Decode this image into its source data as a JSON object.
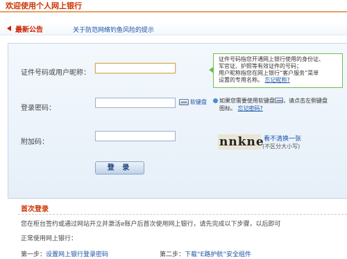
{
  "header": {
    "title": "欢迎使用个人网上银行"
  },
  "notice": {
    "label": "最新公告",
    "link_text": "关于防范网络钓鱼风险的提示"
  },
  "form": {
    "id_label": "证件号码或用户昵称：",
    "password_label": "登录密码：",
    "captcha_label": "附加码：",
    "keyboard_label": "软键盘",
    "captcha_text": "nnkne",
    "captcha_refresh": "看不清换一张",
    "captcha_case_note": "(不区分大小写)",
    "login_button": "登 录"
  },
  "tips": {
    "id_tip_line1": "证件号码指您开通网上银行使用的身份证、",
    "id_tip_line2": "军官证、护照等有效证件的号码；",
    "id_tip_line3": "用户昵称指您在网上银行“客户服务”菜单",
    "id_tip_line4": "设置的专用名称。",
    "id_tip_link": "忘记昵称?",
    "pwd_tip_line1": "如果您需要使用软键盘",
    "pwd_tip_line1b": "，请点击左侧键盘",
    "pwd_tip_line2": "图标。",
    "pwd_tip_link": "忘记密码?"
  },
  "first_login": {
    "title": "首次登录",
    "desc": "您在柜台签约或通过网站开立并激活e账户后首次使用网上银行，请先完成以下步骤，以后即可",
    "normal": "正常使用网上银行：",
    "step1_label": "第一步：",
    "step1_link": "设置网上银行登录密码",
    "step2_label": "第二步：",
    "step2_link": "下载“E路护航”安全组件"
  },
  "colors": {
    "brand": "#cc3300",
    "link": "#1a52a6",
    "tip_border": "#6fbf4a"
  }
}
